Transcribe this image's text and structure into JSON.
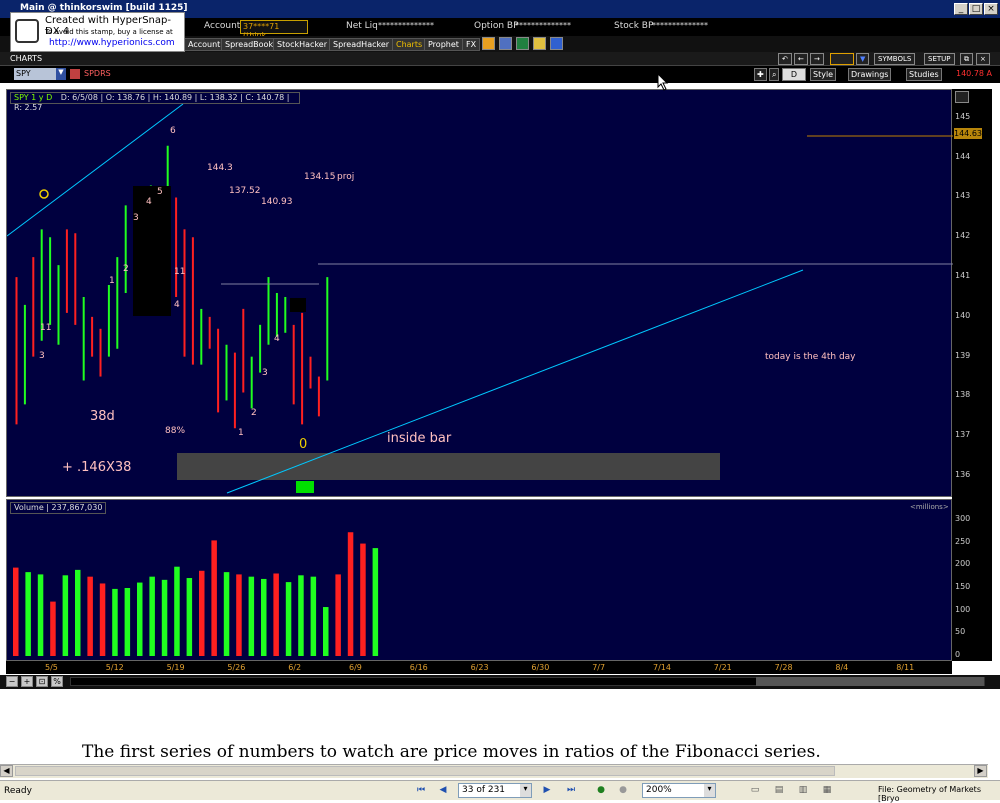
{
  "window": {
    "title": "Main @ thinkorswim [build 1125]"
  },
  "stamp": {
    "line1": "Created with HyperSnap-DX 4",
    "line2": "To avoid this stamp, buy a license at",
    "url": "http://www.hyperionics.com"
  },
  "account": {
    "label": "Account",
    "value": "37****71 (think...",
    "netliq_label": "Net Liq",
    "netliq_value": "**************",
    "optionbp_label": "Option BP",
    "optionbp_value": "**************",
    "stockbp_label": "Stock BP",
    "stockbp_value": "**************"
  },
  "nav": {
    "tabs": [
      "Account",
      "SpreadBook",
      "StockHacker",
      "SpreadHacker",
      "Charts",
      "Prophet",
      "FX"
    ],
    "active": "Charts"
  },
  "charts_header": {
    "label": "CHARTS",
    "symbols": "SYMBOLS",
    "setup": "SETUP"
  },
  "toolbar": {
    "symbol": "SPY",
    "symbol_name": "SPDRS",
    "period": "D",
    "style": "Style",
    "drawings": "Drawings",
    "studies": "Studies",
    "last_price": "140.78 A"
  },
  "info": {
    "symbol": "SPY 1 y D",
    "date": "D: 6/5/08",
    "open": "O: 138.76",
    "high": "H: 140.89",
    "low": "L: 138.32",
    "close": "C: 140.78",
    "range": "R: 2.57"
  },
  "volume": {
    "label": "Volume",
    "value": "237,867,030",
    "units": "<millions>"
  },
  "annotations": {
    "n144": "144.3",
    "n137": "137.52",
    "n140": "140.93",
    "n134": "134.15",
    "proj": "proj",
    "today": "today is the 4th day",
    "d38": "38d",
    "p88": "88%",
    "f146": "+ .146X38",
    "inside": "inside bar",
    "zero": "0",
    "circle": "O"
  },
  "counts": [
    "6",
    "5",
    "4",
    "3",
    "2",
    "1",
    "11",
    "3",
    "11",
    "4",
    "1",
    "2",
    "3",
    "4",
    "1"
  ],
  "price_axis": [
    "145",
    "144",
    "143",
    "142",
    "141",
    "140",
    "139",
    "138",
    "137",
    "136"
  ],
  "price_tag": "144.63",
  "vol_axis": [
    "300",
    "250",
    "200",
    "150",
    "100",
    "50",
    "0"
  ],
  "date_axis": [
    "5/5",
    "5/12",
    "5/19",
    "5/26",
    "6/2",
    "6/9",
    "6/16",
    "6/23",
    "6/30",
    "7/7",
    "7/14",
    "7/21",
    "7/28",
    "8/4",
    "8/11"
  ],
  "chart_data": {
    "type": "bar",
    "ylim": [
      135.7,
      145.6
    ],
    "bars": [
      {
        "h": 141.0,
        "l": 137.3,
        "c": "red"
      },
      {
        "h": 140.3,
        "l": 137.8,
        "c": "green"
      },
      {
        "h": 141.5,
        "l": 139.0,
        "c": "red"
      },
      {
        "h": 142.2,
        "l": 139.4,
        "c": "green"
      },
      {
        "h": 142.0,
        "l": 139.8,
        "c": "green"
      },
      {
        "h": 141.3,
        "l": 139.3,
        "c": "green"
      },
      {
        "h": 142.2,
        "l": 140.1,
        "c": "red"
      },
      {
        "h": 142.1,
        "l": 139.8,
        "c": "red"
      },
      {
        "h": 140.5,
        "l": 138.4,
        "c": "green"
      },
      {
        "h": 140.0,
        "l": 139.0,
        "c": "red"
      },
      {
        "h": 139.7,
        "l": 138.5,
        "c": "red"
      },
      {
        "h": 140.8,
        "l": 139.0,
        "c": "green"
      },
      {
        "h": 141.5,
        "l": 139.2,
        "c": "green"
      },
      {
        "h": 142.8,
        "l": 140.6,
        "c": "green"
      },
      {
        "h": 142.1,
        "l": 140.1,
        "c": "red"
      },
      {
        "h": 143.1,
        "l": 140.7,
        "c": "green"
      },
      {
        "h": 143.3,
        "l": 140.7,
        "c": "green"
      },
      {
        "h": 143.2,
        "l": 141.4,
        "c": "green"
      },
      {
        "h": 144.3,
        "l": 141.6,
        "c": "green"
      },
      {
        "h": 143.0,
        "l": 140.5,
        "c": "red"
      },
      {
        "h": 142.2,
        "l": 139.0,
        "c": "red"
      },
      {
        "h": 142.0,
        "l": 138.8,
        "c": "red"
      },
      {
        "h": 140.2,
        "l": 138.8,
        "c": "green"
      },
      {
        "h": 140.0,
        "l": 139.2,
        "c": "red"
      },
      {
        "h": 139.7,
        "l": 137.6,
        "c": "red"
      },
      {
        "h": 139.3,
        "l": 137.9,
        "c": "green"
      },
      {
        "h": 139.1,
        "l": 137.2,
        "c": "red"
      },
      {
        "h": 140.2,
        "l": 138.1,
        "c": "red"
      },
      {
        "h": 139.0,
        "l": 137.7,
        "c": "green"
      },
      {
        "h": 139.8,
        "l": 138.6,
        "c": "green"
      },
      {
        "h": 141.0,
        "l": 139.3,
        "c": "green"
      },
      {
        "h": 140.6,
        "l": 139.5,
        "c": "green"
      },
      {
        "h": 140.5,
        "l": 139.6,
        "c": "green"
      },
      {
        "h": 139.8,
        "l": 137.8,
        "c": "red"
      },
      {
        "h": 140.1,
        "l": 137.3,
        "c": "red"
      },
      {
        "h": 139.0,
        "l": 138.2,
        "c": "red"
      },
      {
        "h": 138.5,
        "l": 137.5,
        "c": "red"
      },
      {
        "h": 141.0,
        "l": 138.4,
        "c": "green"
      }
    ],
    "volume": [
      {
        "v": 195,
        "c": "red"
      },
      {
        "v": 185,
        "c": "green"
      },
      {
        "v": 180,
        "c": "green"
      },
      {
        "v": 120,
        "c": "red"
      },
      {
        "v": 178,
        "c": "green"
      },
      {
        "v": 190,
        "c": "green"
      },
      {
        "v": 175,
        "c": "red"
      },
      {
        "v": 160,
        "c": "red"
      },
      {
        "v": 148,
        "c": "green"
      },
      {
        "v": 150,
        "c": "green"
      },
      {
        "v": 162,
        "c": "green"
      },
      {
        "v": 175,
        "c": "green"
      },
      {
        "v": 168,
        "c": "green"
      },
      {
        "v": 197,
        "c": "green"
      },
      {
        "v": 172,
        "c": "green"
      },
      {
        "v": 188,
        "c": "red"
      },
      {
        "v": 255,
        "c": "red"
      },
      {
        "v": 185,
        "c": "green"
      },
      {
        "v": 180,
        "c": "red"
      },
      {
        "v": 175,
        "c": "green"
      },
      {
        "v": 170,
        "c": "green"
      },
      {
        "v": 182,
        "c": "red"
      },
      {
        "v": 163,
        "c": "green"
      },
      {
        "v": 178,
        "c": "green"
      },
      {
        "v": 175,
        "c": "green"
      },
      {
        "v": 108,
        "c": "green"
      },
      {
        "v": 180,
        "c": "red"
      },
      {
        "v": 273,
        "c": "red"
      },
      {
        "v": 248,
        "c": "red"
      },
      {
        "v": 238,
        "c": "green"
      }
    ],
    "vol_ylim": [
      0,
      300
    ]
  },
  "document": {
    "text": "The first series of numbers to watch are price moves in ratios of the Fibonacci series."
  },
  "statusbar": {
    "ready": "Ready",
    "page": "33 of 231",
    "zoom": "200%",
    "file": "File: Geometry of Markets [Bryo"
  }
}
